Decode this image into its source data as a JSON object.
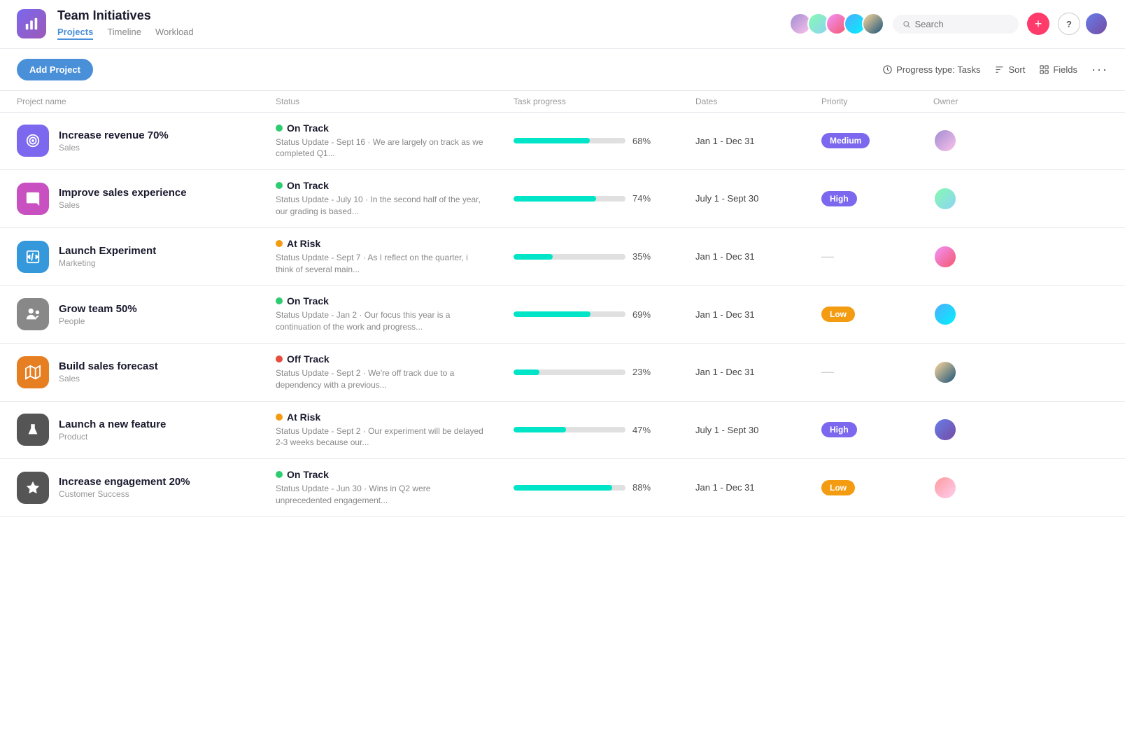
{
  "app": {
    "title": "Team Initiatives",
    "icon_label": "chart-icon"
  },
  "nav": {
    "tabs": [
      {
        "label": "Projects",
        "active": true
      },
      {
        "label": "Timeline",
        "active": false
      },
      {
        "label": "Workload",
        "active": false
      }
    ]
  },
  "header": {
    "search_placeholder": "Search",
    "btn_plus_label": "+",
    "btn_help_label": "?"
  },
  "toolbar": {
    "add_project_label": "Add Project",
    "progress_type_label": "Progress type: Tasks",
    "sort_label": "Sort",
    "fields_label": "Fields"
  },
  "table": {
    "columns": [
      "Project name",
      "Status",
      "Task progress",
      "Dates",
      "Priority",
      "Owner"
    ],
    "rows": [
      {
        "name": "Increase revenue 70%",
        "team": "Sales",
        "icon_color": "#7b68ee",
        "icon_type": "target",
        "status": "On Track",
        "status_type": "on-track",
        "update": "Status Update - Sept 16 · We are largely on track as we completed Q1...",
        "progress": 68,
        "dates": "Jan 1 - Dec 31",
        "priority": "Medium",
        "priority_type": "medium",
        "owner_color": "av1"
      },
      {
        "name": "Improve sales experience",
        "team": "Sales",
        "icon_color": "#c850c0",
        "icon_type": "chat",
        "status": "On Track",
        "status_type": "on-track",
        "update": "Status Update - July 10 · In the second half of the year, our grading is based...",
        "progress": 74,
        "dates": "July 1 - Sept 30",
        "priority": "High",
        "priority_type": "high",
        "owner_color": "av2"
      },
      {
        "name": "Launch Experiment",
        "team": "Marketing",
        "icon_color": "#3498db",
        "icon_type": "code",
        "status": "At Risk",
        "status_type": "at-risk",
        "update": "Status Update - Sept 7 · As I reflect on the quarter, i think of several main...",
        "progress": 35,
        "dates": "Jan 1 - Dec 31",
        "priority": "—",
        "priority_type": "none",
        "owner_color": "av3"
      },
      {
        "name": "Grow team 50%",
        "team": "People",
        "icon_color": "#888",
        "icon_type": "people",
        "status": "On Track",
        "status_type": "on-track",
        "update": "Status Update - Jan 2 · Our focus this year is a continuation of the work and progress...",
        "progress": 69,
        "dates": "Jan 1 - Dec 31",
        "priority": "Low",
        "priority_type": "low",
        "owner_color": "av4"
      },
      {
        "name": "Build sales forecast",
        "team": "Sales",
        "icon_color": "#e67e22",
        "icon_type": "map",
        "status": "Off Track",
        "status_type": "off-track",
        "update": "Status Update - Sept 2 · We're off track due to a dependency with a previous...",
        "progress": 23,
        "dates": "Jan 1 - Dec 31",
        "priority": "—",
        "priority_type": "none",
        "owner_color": "av5"
      },
      {
        "name": "Launch a new feature",
        "team": "Product",
        "icon_color": "#555",
        "icon_type": "flask",
        "status": "At Risk",
        "status_type": "at-risk",
        "update": "Status Update - Sept 2 · Our experiment will be delayed 2-3 weeks because our...",
        "progress": 47,
        "dates": "July 1 - Sept 30",
        "priority": "High",
        "priority_type": "high",
        "owner_color": "av6"
      },
      {
        "name": "Increase engagement 20%",
        "team": "Customer Success",
        "icon_color": "#555",
        "icon_type": "star",
        "status": "On Track",
        "status_type": "on-track",
        "update": "Status Update - Jun 30 · Wins in Q2 were unprecedented engagement...",
        "progress": 88,
        "dates": "Jan 1 - Dec 31",
        "priority": "Low",
        "priority_type": "low",
        "owner_color": "av7"
      }
    ]
  }
}
